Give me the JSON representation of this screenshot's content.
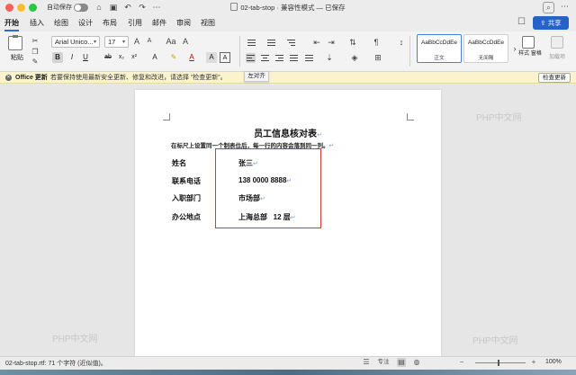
{
  "window": {
    "autosave_label": "自动保存",
    "title": "02-tab-stop · 兼容性模式 — 已保存",
    "share_label": "共享"
  },
  "tabs": [
    "开始",
    "插入",
    "绘图",
    "设计",
    "布局",
    "引用",
    "邮件",
    "审阅",
    "视图"
  ],
  "ribbon": {
    "paste_label": "粘贴",
    "font_name": "Arial Unico...",
    "font_size": "17",
    "style_samples": [
      {
        "sample": "AaBbCcDdEe",
        "name": "正文"
      },
      {
        "sample": "AaBbCcDdEe",
        "name": "无间隔"
      }
    ],
    "styles_pane_label": "样式\n窗格",
    "addins_label": "加载项"
  },
  "notice": {
    "title": "Office 更新",
    "text": "若要保持使用最新安全更新、修复和改进，请选择 “检查更新”。",
    "button": "检查更新"
  },
  "tooltip": "左对齐",
  "document": {
    "heading": "员工信息核对表",
    "intro": "在标尺上设置同一个制表位后，每一行的内容会落到同一列。",
    "paragraph_mark": "↵",
    "rows": [
      {
        "label": "姓名",
        "value": "张三"
      },
      {
        "label": "联系电话",
        "value": "138 0000 8888"
      },
      {
        "label": "入职部门",
        "value": "市场部"
      },
      {
        "label": "办公地点",
        "value": "上海总部   12 层"
      }
    ]
  },
  "watermark": "PHP中文网",
  "status": {
    "text": "02-tab-stop.rtf: 71 个字符 (近似值)。",
    "focus_label": "专注",
    "zoom": "100%"
  },
  "colors": {
    "accent": "#2563c9",
    "highlight_box": "#d23b3b",
    "notice_bg": "#fbf3d0"
  }
}
